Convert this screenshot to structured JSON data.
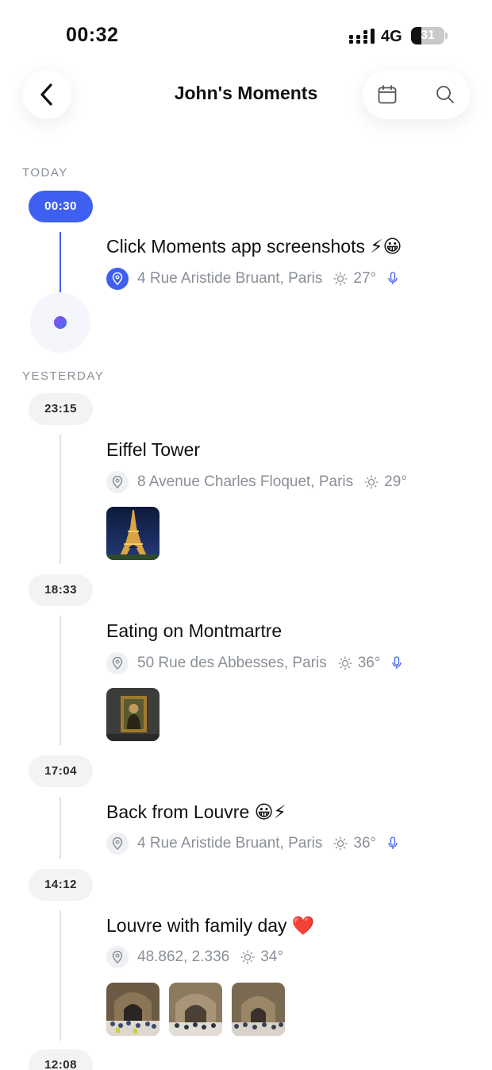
{
  "status_bar": {
    "time": "00:32",
    "network": "4G",
    "battery": "31",
    "battery_level": 0.31
  },
  "header": {
    "title": "John's Moments"
  },
  "sections": {
    "today": "TODAY",
    "yesterday": "YESTERDAY"
  },
  "moments": [
    {
      "time": "00:30",
      "title": "Click Moments app screenshots ⚡😀",
      "location": "4 Rue Aristide Bruant, Paris",
      "temperature": "27°",
      "has_voice": true
    },
    {
      "time": "23:15",
      "title": "Eiffel Tower",
      "location": "8 Avenue Charles Floquet, Paris",
      "temperature": "29°",
      "has_voice": false,
      "photos": [
        "eiffel-tower-photo"
      ]
    },
    {
      "time": "18:33",
      "title": "Eating on Montmartre",
      "location": "50 Rue des Abbesses, Paris",
      "temperature": "36°",
      "has_voice": true,
      "photos": [
        "mona-lisa-photo"
      ]
    },
    {
      "time": "17:04",
      "title": "Back from Louvre 😀⚡",
      "location": "4 Rue Aristide Bruant, Paris",
      "temperature": "36°",
      "has_voice": true
    },
    {
      "time": "14:12",
      "title": "Louvre with family day ❤️",
      "location": "48.862, 2.336",
      "temperature": "34°",
      "has_voice": false,
      "photos": [
        "louvre-hall-photo",
        "louvre-hall-photo",
        "louvre-hall-photo"
      ]
    },
    {
      "time": "12:08"
    }
  ],
  "colors": {
    "accent": "#3f5ff0",
    "muted_text": "#8a8f98",
    "pill_bg": "#f2f3f5",
    "line": "#dfe1e5"
  },
  "icons": [
    "back-chevron-icon",
    "calendar-icon",
    "search-icon",
    "location-pin-icon",
    "sun-icon",
    "microphone-icon",
    "signal-icon"
  ]
}
